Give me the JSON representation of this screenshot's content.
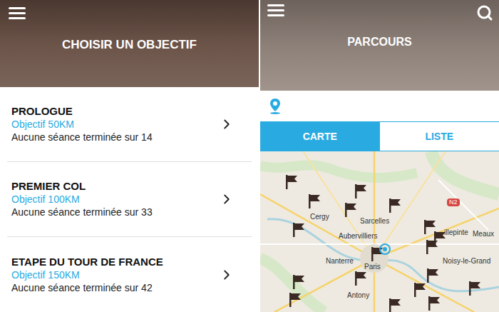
{
  "left": {
    "header": {
      "title": "CHOISIR UN OBJECTIF"
    },
    "goals": [
      {
        "title": "PROLOGUE",
        "objective": "Objectif 50KM",
        "progress": "Aucune séance terminée sur 14"
      },
      {
        "title": "PREMIER COL",
        "objective": "Objectif 100KM",
        "progress": "Aucune séance terminée sur 33"
      },
      {
        "title": "ETAPE DU TOUR DE FRANCE",
        "objective": "Objectif 150KM",
        "progress": "Aucune séance terminée sur 42"
      }
    ]
  },
  "right": {
    "header": {
      "title": "PARCOURS"
    },
    "tabs": [
      {
        "label": "CARTE",
        "selected": true
      },
      {
        "label": "LISTE",
        "selected": false
      }
    ],
    "map": {
      "labels": [
        "Cergy",
        "Sarcelles",
        "Aubervilliers",
        "Nanterre",
        "Paris",
        "Antony",
        "Noisy-le-Grand",
        "illepinte",
        "Meaux"
      ],
      "road_badge": "N2"
    }
  }
}
